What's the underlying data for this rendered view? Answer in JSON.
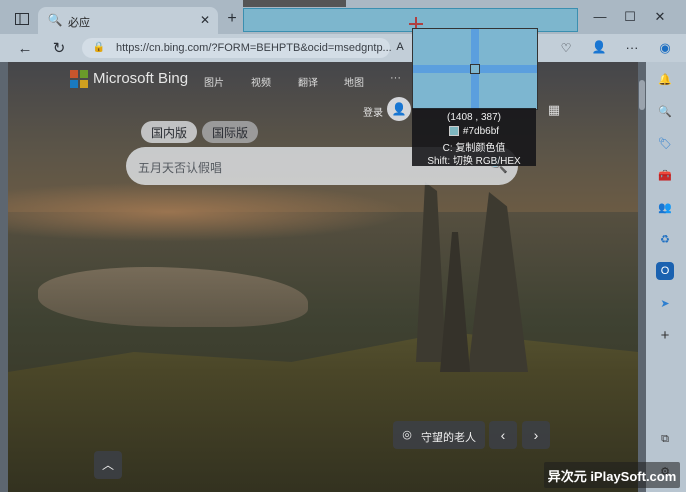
{
  "browser": {
    "tab_title": "必应",
    "url": "https://cn.bing.com/?FORM=BEHPTB&ocid=msedgntp..."
  },
  "bing": {
    "logo_text": "Microsoft Bing",
    "nav": [
      "图片",
      "视频",
      "翻译",
      "地图",
      "···"
    ],
    "login_label": "登录",
    "region_tabs": [
      "国内版",
      "国际版"
    ],
    "search_placeholder": "五月天否认假唱",
    "location_label": "守望的老人"
  },
  "color_picker": {
    "coordinates": "(1408 , 387)",
    "hex_value": "#7db6bf",
    "hint_copy": "C: 复制颜色值",
    "hint_switch": "Shift: 切换 RGB/HEX",
    "swatch_color": "#7db6bf"
  },
  "watermark": "异次元 iPlaySoft.com",
  "colors": {
    "selection": "#7db6cd",
    "chrome": "#aab8c4"
  }
}
